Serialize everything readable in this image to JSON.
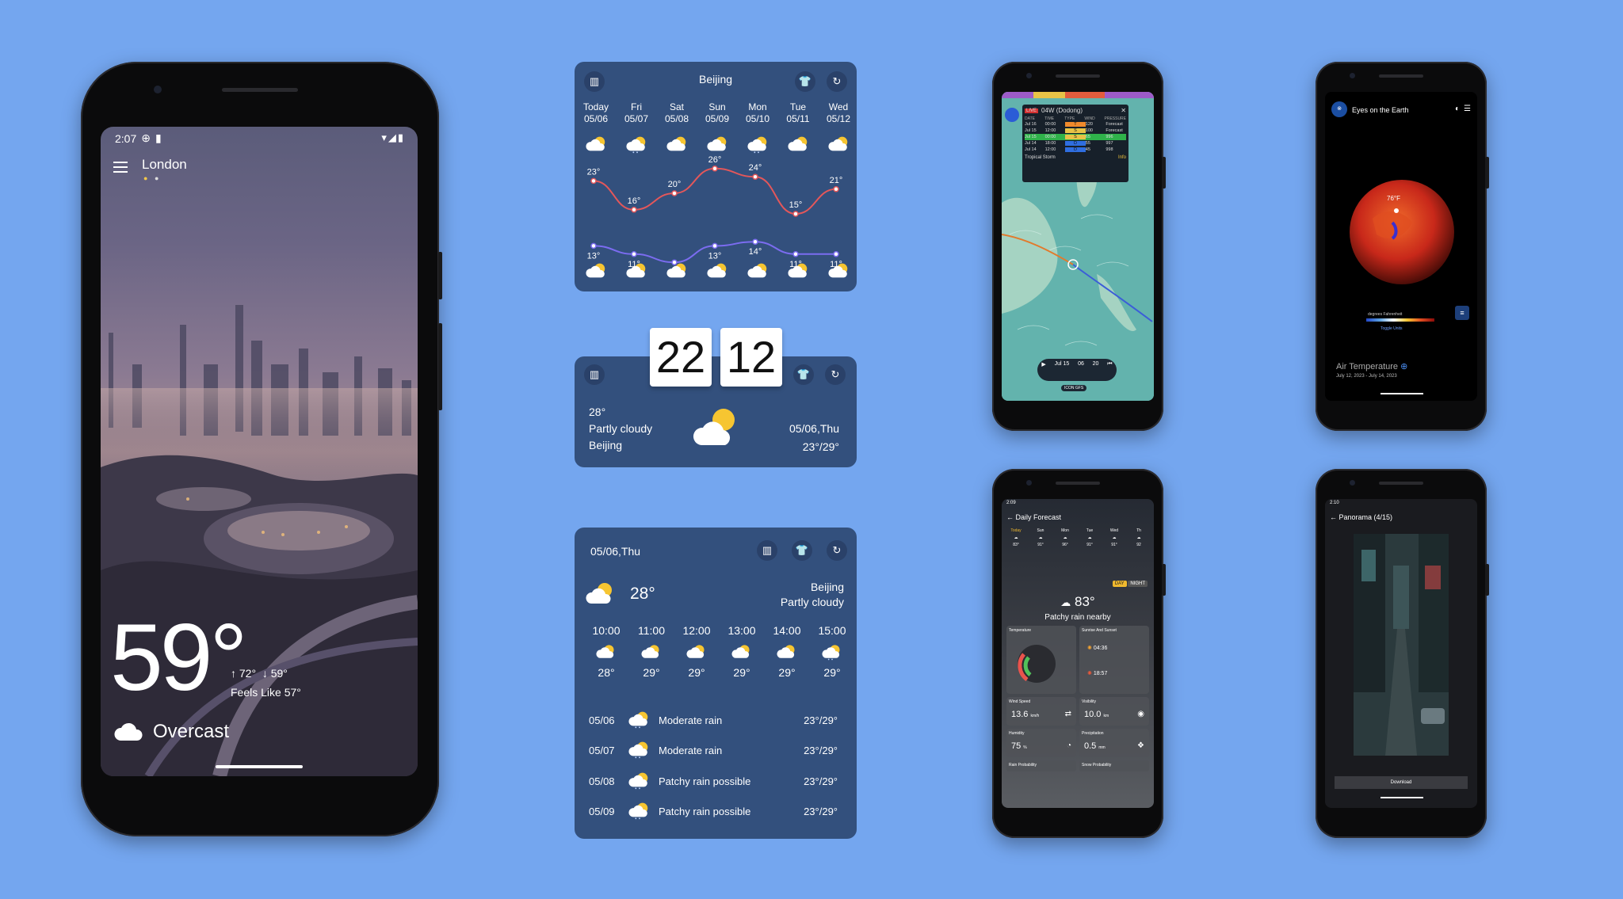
{
  "main_phone": {
    "status_time": "2:07",
    "city": "London",
    "temperature": "59°",
    "high": "72°",
    "low": "59°",
    "feels_like": "Feels Like 57°",
    "condition": "Overcast"
  },
  "forecast_widget": {
    "city": "Beijing",
    "days": [
      {
        "name": "Today",
        "date": "05/06",
        "high": "23°",
        "low": "13°"
      },
      {
        "name": "Fri",
        "date": "05/07",
        "high": "16°",
        "low": "11°"
      },
      {
        "name": "Sat",
        "date": "05/08",
        "high": "20°",
        "low": "9°"
      },
      {
        "name": "Sun",
        "date": "05/09",
        "high": "26°",
        "low": "13°"
      },
      {
        "name": "Mon",
        "date": "05/10",
        "high": "24°",
        "low": "14°"
      },
      {
        "name": "Tue",
        "date": "05/11",
        "high": "15°",
        "low": "11°"
      },
      {
        "name": "Wed",
        "date": "05/12",
        "high": "21°",
        "low": "11°"
      }
    ],
    "high_values": [
      23,
      16,
      20,
      26,
      24,
      15,
      21
    ],
    "low_values": [
      13,
      11,
      9,
      13,
      14,
      11,
      11
    ],
    "colors": {
      "high_line": "#e4575a",
      "low_line": "#7b6cf0"
    }
  },
  "clock_widget": {
    "hour": "22",
    "minute": "12",
    "temp": "28°",
    "condition": "Partly cloudy",
    "city": "Beijing",
    "date": "05/06,Thu",
    "range": "23°/29°"
  },
  "hourly_widget": {
    "date": "05/06,Thu",
    "temp": "28°",
    "city": "Beijing",
    "condition": "Partly cloudy",
    "hours": [
      {
        "time": "10:00",
        "temp": "28°"
      },
      {
        "time": "11:00",
        "temp": "29°"
      },
      {
        "time": "12:00",
        "temp": "29°"
      },
      {
        "time": "13:00",
        "temp": "29°"
      },
      {
        "time": "14:00",
        "temp": "29°"
      },
      {
        "time": "15:00",
        "temp": "29°"
      }
    ],
    "daily": [
      {
        "date": "05/06",
        "desc": "Moderate rain",
        "range": "23°/29°"
      },
      {
        "date": "05/07",
        "desc": "Moderate rain",
        "range": "23°/29°"
      },
      {
        "date": "05/08",
        "desc": "Patchy rain possible",
        "range": "23°/29°"
      },
      {
        "date": "05/09",
        "desc": "Patchy rain possible",
        "range": "23°/29°"
      }
    ]
  },
  "storm_phone": {
    "storm": "04W (Dodong)",
    "live": "LIVE",
    "header": [
      "DATE",
      "TIME",
      "TYPE",
      "WIND",
      "PRESSURE"
    ],
    "rows": [
      [
        "Jul 16",
        "00:00",
        "T",
        "120",
        "Forecast"
      ],
      [
        "Jul 15",
        "12:00",
        "S",
        "100",
        "Forecast"
      ],
      [
        "Jul 15",
        "00:00",
        "S",
        "65",
        "996"
      ],
      [
        "Jul 14",
        "18:00",
        "D",
        "55",
        "997"
      ],
      [
        "Jul 14",
        "12:00",
        "D",
        "45",
        "998"
      ]
    ],
    "legend": "Tropical Storm",
    "info": "Info",
    "timeline_date": "Jul 15",
    "timeline_h": "06",
    "timeline_m": "20",
    "model_a": "ICON",
    "model_b": "GFS"
  },
  "earth_phone": {
    "title": "Eyes on the Earth",
    "reading": "76°F",
    "scale_label": "degrees Fahrenheit",
    "toggle": "Toggle Units",
    "metric": "Air Temperature",
    "dates": "July 12, 2023 - July 14, 2023"
  },
  "daily_phone": {
    "time": "2:09",
    "title": "Daily Forecast",
    "days": [
      "Today",
      "Sun",
      "Mon",
      "Tue",
      "Wed",
      "Th"
    ],
    "temps": [
      "83°",
      "91°",
      "96°",
      "91°",
      "91°",
      "92"
    ],
    "day_btn": "DAY",
    "night_btn": "NIGHT",
    "temp": "83°",
    "condition": "Patchy rain nearby",
    "temperature_label": "Temperature",
    "sunrise_label": "Sunrise And Sunset",
    "sunrise": "04:36",
    "sunset": "18:57",
    "wind_label": "Wind Speed",
    "wind": "13.6",
    "wind_unit": "km/h",
    "vis_label": "Visibility",
    "vis": "10.0",
    "vis_unit": "km",
    "hum_label": "Humidity",
    "hum": "75",
    "hum_unit": "%",
    "precip_label": "Precipitation",
    "precip": "0.5",
    "precip_unit": "mm",
    "rain_prob": "Rain Probability",
    "snow_prob": "Snow Probability"
  },
  "panorama_phone": {
    "time": "2:10",
    "title": "Panorama (4/15)",
    "download": "Download"
  }
}
